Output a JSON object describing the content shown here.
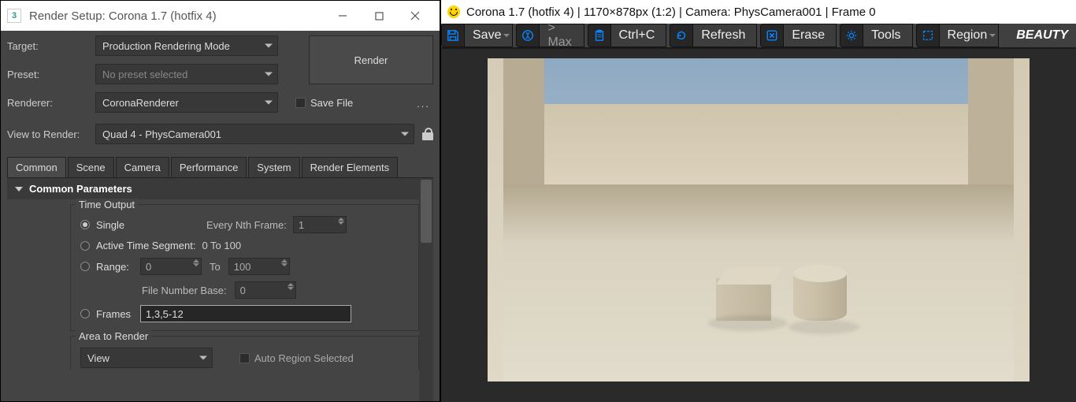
{
  "rs": {
    "title": "Render Setup: Corona 1.7 (hotfix 4)",
    "labels": {
      "target": "Target:",
      "preset": "Preset:",
      "renderer": "Renderer:",
      "view": "View to Render:",
      "savefile": "Save File"
    },
    "values": {
      "target": "Production Rendering Mode",
      "preset": "No preset selected",
      "renderer": "CoronaRenderer",
      "view": "Quad 4 - PhysCamera001"
    },
    "render_btn": "Render",
    "tabs": [
      "Common",
      "Scene",
      "Camera",
      "Performance",
      "System",
      "Render Elements"
    ],
    "panel_title": "Common Parameters",
    "time_output": {
      "group": "Time Output",
      "single": "Single",
      "every_nth": "Every Nth Frame:",
      "every_nth_val": "1",
      "active_seg": "Active Time Segment:",
      "active_seg_val": "0 To 100",
      "range": "Range:",
      "range_from": "0",
      "range_to_lbl": "To",
      "range_to": "100",
      "file_base": "File Number Base:",
      "file_base_val": "0",
      "frames": "Frames",
      "frames_val": "1,3,5-12"
    },
    "area": {
      "group": "Area to Render",
      "view": "View",
      "auto_region": "Auto Region Selected"
    }
  },
  "vfb": {
    "title": "Corona 1.7 (hotfix 4) | 1170×878px (1:2) | Camera: PhysCamera001 | Frame 0",
    "buttons": {
      "save": "Save",
      "max": "> Max",
      "ctrlc": "Ctrl+C",
      "refresh": "Refresh",
      "erase": "Erase",
      "tools": "Tools",
      "region": "Region"
    },
    "pass": "BEAUTY"
  },
  "colors": {
    "accent": "#0080ff"
  }
}
